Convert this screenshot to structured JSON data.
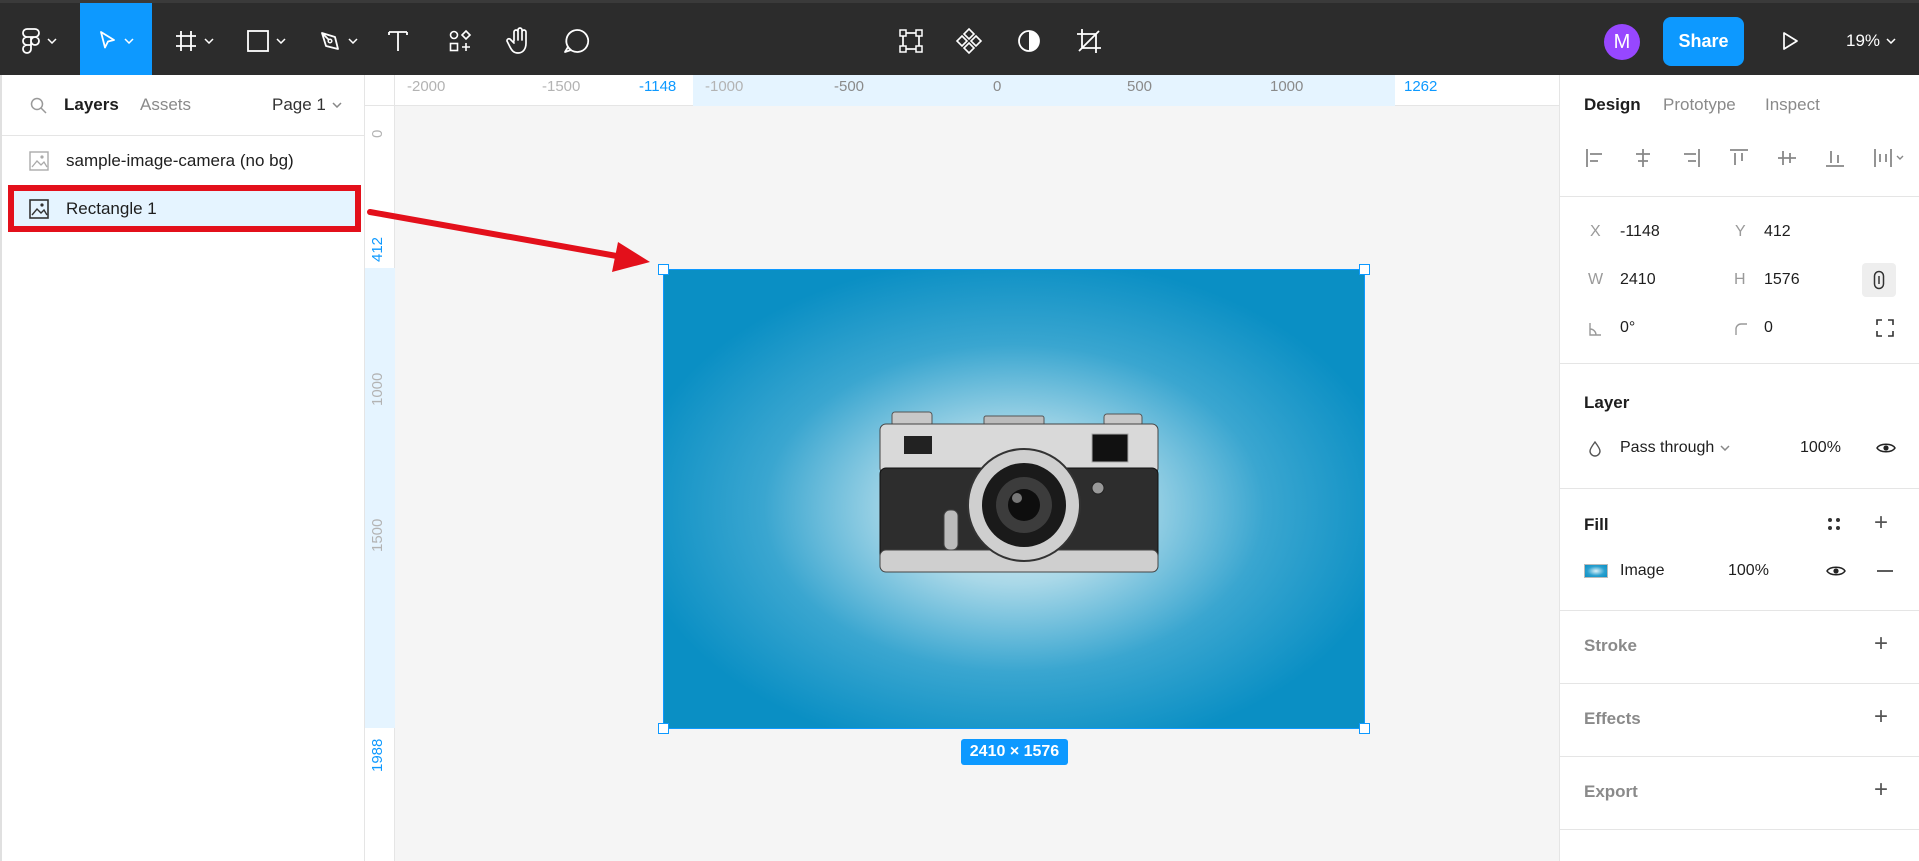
{
  "toolbar": {
    "tools": [
      {
        "name": "main-menu",
        "icon": "figma-logo-icon"
      },
      {
        "name": "move",
        "icon": "cursor-icon",
        "active": true
      },
      {
        "name": "frame",
        "icon": "frame-hash-icon"
      },
      {
        "name": "shape",
        "icon": "rectangle-icon"
      },
      {
        "name": "pen",
        "icon": "pen-icon"
      },
      {
        "name": "text",
        "icon": "text-icon"
      },
      {
        "name": "resources",
        "icon": "components-icon"
      },
      {
        "name": "hand",
        "icon": "hand-icon"
      },
      {
        "name": "comment",
        "icon": "comment-icon"
      }
    ],
    "context_tools": [
      "edit-object-icon",
      "create-component-icon",
      "mask-icon",
      "crop-icon"
    ],
    "avatar_initial": "M",
    "share_label": "Share",
    "zoom": "19%"
  },
  "left_panel": {
    "tabs": {
      "layers": "Layers",
      "assets": "Assets"
    },
    "page": "Page 1",
    "layers": [
      {
        "name": "sample-image-camera (no bg)",
        "selected": false
      },
      {
        "name": "Rectangle 1",
        "selected": true
      }
    ]
  },
  "canvas": {
    "ruler_h": [
      "-2000",
      "-1500",
      "-1148",
      "-1000",
      "-500",
      "0",
      "500",
      "1000",
      "1262"
    ],
    "ruler_v": [
      "0",
      "412",
      "1000",
      "1500",
      "1988"
    ],
    "size_label": "2410 × 1576",
    "background_accent": "#0a8fc4"
  },
  "right_panel": {
    "tabs": {
      "design": "Design",
      "prototype": "Prototype",
      "inspect": "Inspect"
    },
    "x_label": "X",
    "x": "-1148",
    "y_label": "Y",
    "y": "412",
    "w_label": "W",
    "w": "2410",
    "h_label": "H",
    "h": "1576",
    "rotation": "0°",
    "radius": "0",
    "layer": {
      "title": "Layer",
      "blend": "Pass through",
      "opacity": "100%"
    },
    "fill": {
      "title": "Fill",
      "type": "Image",
      "opacity": "100%"
    },
    "stroke": {
      "title": "Stroke"
    },
    "effects": {
      "title": "Effects"
    },
    "export": {
      "title": "Export"
    }
  },
  "colors": {
    "accent": "#0d99ff",
    "highlight": "#e3101b",
    "avatar": "#9747ff"
  }
}
